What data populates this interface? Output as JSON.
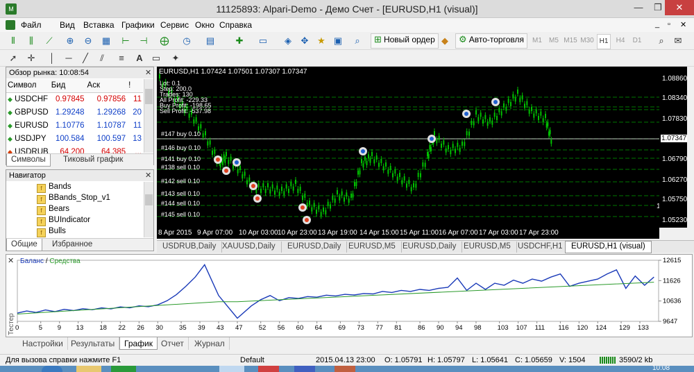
{
  "window": {
    "title": "11125893: Alpari-Demo - Демо Счет - [EURUSD,H1 (visual)]",
    "minimize": "—",
    "maximize": "❐",
    "close": "✕"
  },
  "menu": [
    "Файл",
    "Вид",
    "Вставка",
    "Графики",
    "Сервис",
    "Окно",
    "Справка"
  ],
  "mdi_controls": [
    "_",
    "▫",
    "✕"
  ],
  "toolbar": {
    "new_order": "Новый ордер",
    "auto_trading": "Авто-торговля",
    "timeframes": [
      "M1",
      "M5",
      "M15",
      "M30",
      "H1",
      "H4",
      "D1"
    ],
    "active_timeframe": "H1"
  },
  "market_watch": {
    "title": "Обзор рынка: 10:08:54",
    "columns": [
      "Символ",
      "Бид",
      "Аск",
      "!"
    ],
    "rows": [
      {
        "symbol": "USDCHF",
        "bid": "0.97845",
        "ask": "0.97856",
        "spread": "11",
        "color": "red",
        "dir": "up"
      },
      {
        "symbol": "GBPUSD",
        "bid": "1.29248",
        "ask": "1.29268",
        "spread": "20",
        "color": "blue",
        "dir": "up"
      },
      {
        "symbol": "EURUSD",
        "bid": "1.10776",
        "ask": "1.10787",
        "spread": "11",
        "color": "blue",
        "dir": "up"
      },
      {
        "symbol": "USDJPY",
        "bid": "100.584",
        "ask": "100.597",
        "spread": "13",
        "color": "blue",
        "dir": "up"
      },
      {
        "symbol": "USDRUB",
        "bid": "64.200",
        "ask": "64.385",
        "spread": "...",
        "color": "red",
        "dir": "down"
      }
    ],
    "tabs": [
      "Символы",
      "Тиковый график"
    ]
  },
  "navigator": {
    "title": "Навигатор",
    "items": [
      "Bands",
      "BBands_Stop_v1",
      "Bears",
      "BUIndicator",
      "Bulls"
    ],
    "tabs": [
      "Общие",
      "Избранное"
    ]
  },
  "chart": {
    "header": "EURUSD,H1  1.07424 1.07501 1.07307 1.07347",
    "info_lines": [
      "Lot: 0.1",
      "Step: 200.0",
      "Trades: 130",
      "All Profit: -229.33",
      "Buy Profit: -198.65",
      "Sell Profit: -537.98"
    ],
    "order_labels": [
      "#147 buy 0.10",
      "#146 buy 0.10",
      "#141 buy 0.10",
      "#138 sell 0.10",
      "#142 sell 0.10",
      "#143 sell 0.10",
      "#144 sell 0.10",
      "#145 sell 0.10"
    ],
    "price_labels": [
      "1.08860",
      "1.08340",
      "1.07830",
      "1.07347",
      "1.06790",
      "1.06270",
      "1.05750",
      "1.05230"
    ],
    "current_price": "1.07347",
    "time_labels": [
      "8 Apr 2015",
      "9 Apr 07:00",
      "10 Apr 03:00",
      "10 Apr 23:00",
      "13 Apr 19:00",
      "14 Apr 15:00",
      "15 Apr 11:00",
      "16 Apr 07:00",
      "17 Apr 03:00",
      "17 Apr 23:00"
    ],
    "colors": {
      "background": "#000000",
      "candles": "#00c000",
      "grid": "#00a000",
      "buy_marker": "#2060d0",
      "sell_marker": "#e04020"
    }
  },
  "chart_tabs": [
    "USDRUB,Daily",
    "XAUUSD,Daily",
    "EURUSD,Daily",
    "EURUSD,M5",
    "EURUSD,Daily",
    "EURUSD,M5",
    "USDCHF,H1",
    "EURUSD,H1 (visual)"
  ],
  "active_chart_tab": "EURUSD,H1 (visual)",
  "tester": {
    "legend_balance": "Баланс",
    "legend_sep": " / ",
    "legend_equity": "Средства",
    "side_label": "Тестер",
    "y_labels": [
      "12615",
      "11626",
      "10636",
      "9647"
    ],
    "x_labels": [
      "0",
      "5",
      "9",
      "13",
      "18",
      "22",
      "26",
      "30",
      "35",
      "39",
      "43",
      "47",
      "52",
      "56",
      "60",
      "64",
      "69",
      "73",
      "77",
      "81",
      "86",
      "90",
      "94",
      "98",
      "103",
      "107",
      "111",
      "116",
      "120",
      "124",
      "129",
      "133"
    ],
    "tabs": [
      "Настройки",
      "Результаты",
      "График",
      "Отчет",
      "Журнал"
    ],
    "active_tab": "График"
  },
  "chart_data": {
    "type": "line",
    "ylim": [
      9647,
      12615
    ],
    "xlim": [
      0,
      137
    ],
    "series": [
      {
        "name": "Баланс",
        "color": "#1a3ab8",
        "x": [
          0,
          2,
          4,
          6,
          8,
          10,
          12,
          14,
          16,
          18,
          20,
          22,
          24,
          26,
          28,
          30,
          32,
          34,
          36,
          38,
          40,
          43,
          47,
          50,
          52,
          54,
          56,
          58,
          60,
          62,
          64,
          66,
          68,
          70,
          72,
          74,
          76,
          78,
          80,
          82,
          84,
          86,
          88,
          90,
          92,
          94,
          96,
          98,
          100,
          102,
          104,
          106,
          108,
          110,
          112,
          114,
          116,
          118,
          120,
          122,
          124,
          126,
          128,
          130,
          132,
          134,
          136
        ],
        "y": [
          10050,
          10150,
          10080,
          10200,
          10120,
          10230,
          10170,
          10260,
          10210,
          10300,
          10250,
          10350,
          10300,
          10400,
          10360,
          10450,
          10650,
          10950,
          11350,
          11800,
          12400,
          10900,
          9800,
          10400,
          10700,
          10900,
          10650,
          10800,
          10760,
          10850,
          10820,
          10920,
          10880,
          10960,
          10930,
          11000,
          10980,
          11100,
          11050,
          11150,
          11100,
          11200,
          11150,
          11250,
          11300,
          11750,
          11150,
          11500,
          11200,
          11500,
          11400,
          11650,
          11500,
          11700,
          11600,
          11800,
          11950,
          11350,
          11500,
          11600,
          11700,
          11950,
          12150,
          11250,
          11850,
          11400,
          11800
        ]
      },
      {
        "name": "Средства",
        "color": "#2a9a2a",
        "x": [
          0,
          43,
          47,
          136
        ],
        "y": [
          10000,
          10600,
          10600,
          11550
        ]
      }
    ]
  },
  "status": {
    "help": "Для вызова справки нажмите F1",
    "profile": "Default",
    "datetime": "2015.04.13 23:00",
    "open": "O: 1.05791",
    "high": "H: 1.05797",
    "low": "L: 1.05641",
    "close": "C: 1.05659",
    "volume": "V: 1504",
    "connection": "3590/2 kb"
  },
  "clock": "10:08"
}
